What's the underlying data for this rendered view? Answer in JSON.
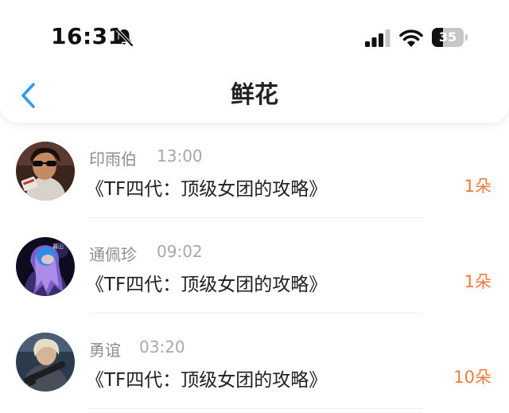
{
  "status_bar": {
    "time": "16:31",
    "battery_level": "35",
    "battery_fraction": 0.35,
    "icons": [
      "bell-slash-icon",
      "cellular-signal-icon",
      "wifi-icon",
      "battery-icon"
    ]
  },
  "nav": {
    "title": "鲜花",
    "back_icon": "chevron-left-icon",
    "accent_color": "#2f9bf2"
  },
  "colors": {
    "count_color": "#f07c3b",
    "name_color": "#8e8e8e",
    "title_color": "#1f1f1f"
  },
  "items": [
    {
      "name": "印雨伯",
      "time": "13:00",
      "title": "《TF四代：顶级女团的攻略》",
      "count": "1朵"
    },
    {
      "name": "通佩珍",
      "time": "09:02",
      "title": "《TF四代：顶级女团的攻略》",
      "count": "1朵"
    },
    {
      "name": "勇谊",
      "time": "03:20",
      "title": "《TF四代：顶级女团的攻略》",
      "count": "10朵"
    }
  ]
}
